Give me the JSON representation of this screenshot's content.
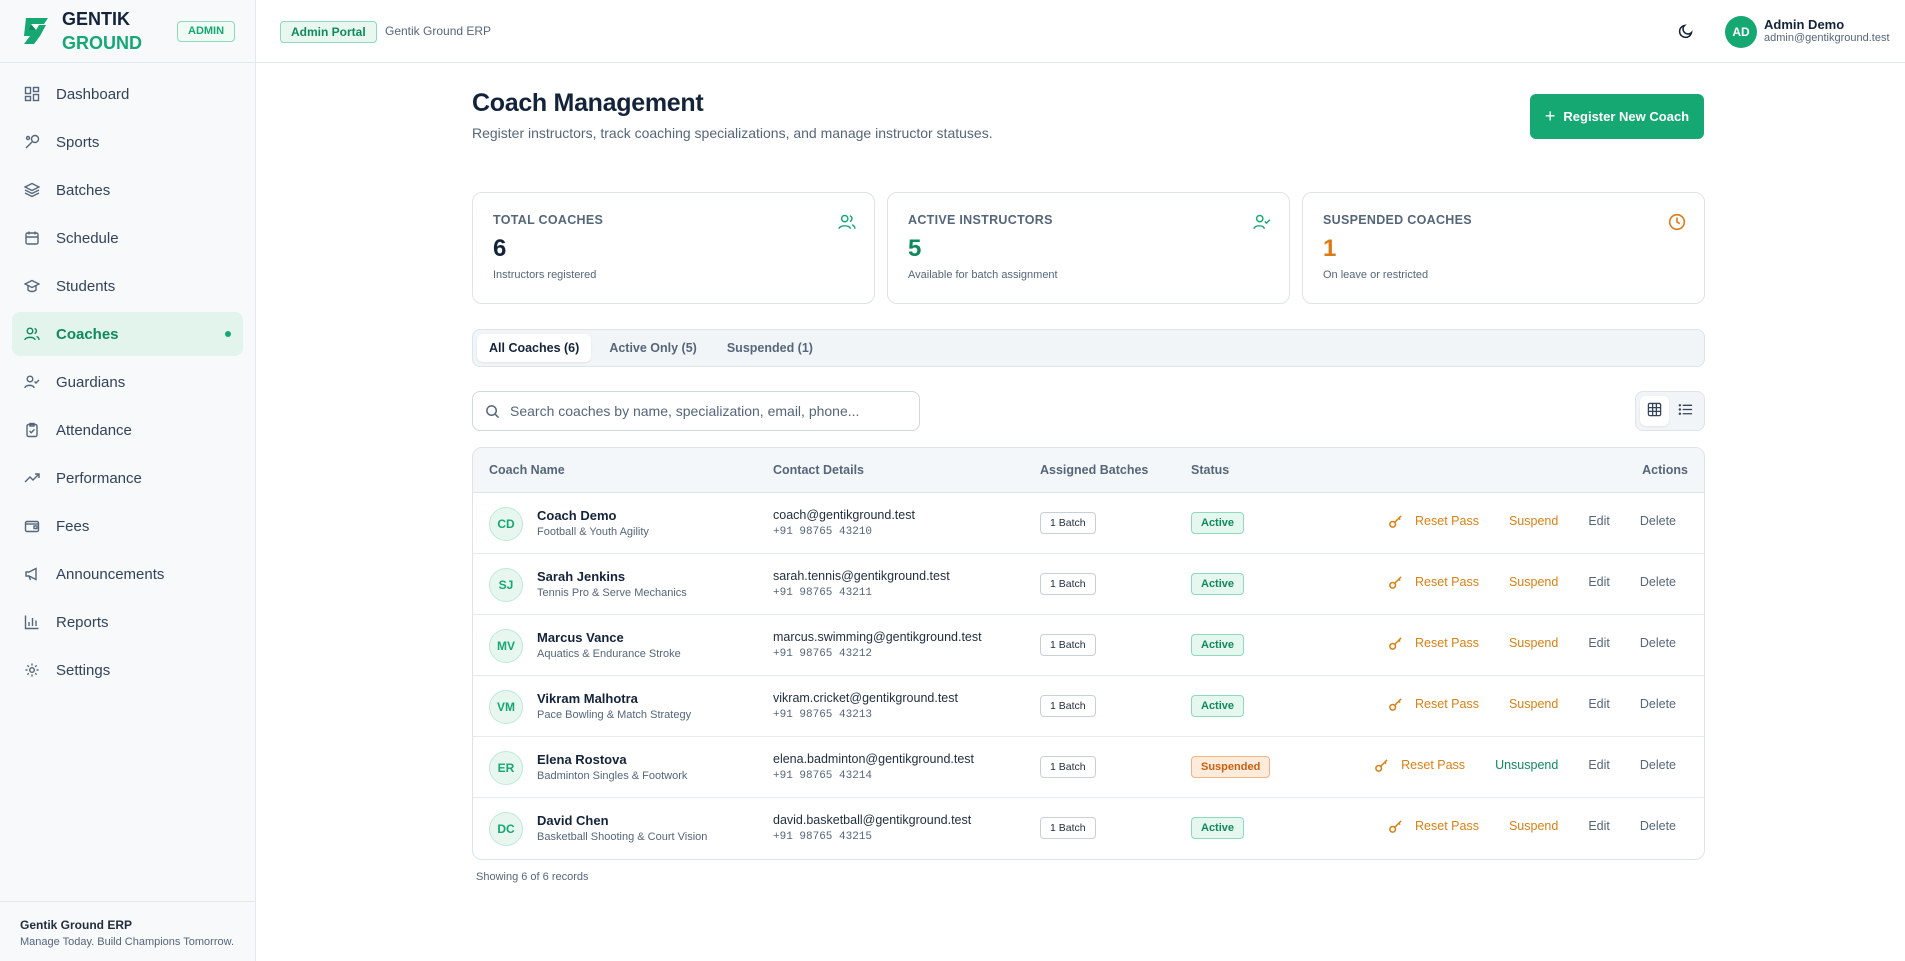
{
  "brand": {
    "line1": "GENTIK",
    "line2": "GROUND",
    "badge": "ADMIN"
  },
  "topbar": {
    "portal_badge": "Admin Portal",
    "portal_sub": "Gentik Ground ERP",
    "theme_icon": "moon-icon"
  },
  "user": {
    "initials": "AD",
    "name": "Admin Demo",
    "email": "admin@gentikground.test"
  },
  "sidebar": {
    "items": [
      {
        "label": "Dashboard",
        "icon": "dashboard-icon"
      },
      {
        "label": "Sports",
        "icon": "sports-icon"
      },
      {
        "label": "Batches",
        "icon": "layers-icon"
      },
      {
        "label": "Schedule",
        "icon": "calendar-icon"
      },
      {
        "label": "Students",
        "icon": "graduation-cap-icon"
      },
      {
        "label": "Coaches",
        "icon": "users-icon",
        "active": true
      },
      {
        "label": "Guardians",
        "icon": "user-check-icon"
      },
      {
        "label": "Attendance",
        "icon": "clipboard-check-icon"
      },
      {
        "label": "Performance",
        "icon": "trending-up-icon"
      },
      {
        "label": "Fees",
        "icon": "wallet-icon"
      },
      {
        "label": "Announcements",
        "icon": "megaphone-icon"
      },
      {
        "label": "Reports",
        "icon": "bar-chart-icon"
      },
      {
        "label": "Settings",
        "icon": "gear-icon"
      }
    ],
    "footer_title": "Gentik Ground ERP",
    "footer_tagline": "Manage Today. Build Champions Tomorrow."
  },
  "page": {
    "title": "Coach Management",
    "subtitle": "Register instructors, track coaching specializations, and manage instructor statuses.",
    "register_button": "Register New Coach"
  },
  "stats": [
    {
      "label": "TOTAL COACHES",
      "value": "6",
      "note": "Instructors registered",
      "icon": "users-icon"
    },
    {
      "label": "ACTIVE INSTRUCTORS",
      "value": "5",
      "note": "Available for batch assignment",
      "icon": "user-check-icon"
    },
    {
      "label": "SUSPENDED COACHES",
      "value": "1",
      "note": "On leave or restricted",
      "icon": "clock-icon"
    }
  ],
  "tabs": [
    "All Coaches (6)",
    "Active Only (5)",
    "Suspended (1)"
  ],
  "search": {
    "placeholder": "Search coaches by name, specialization, email, phone..."
  },
  "table": {
    "headers": {
      "name": "Coach Name",
      "contact": "Contact Details",
      "batches": "Assigned Batches",
      "status": "Status",
      "actions": "Actions"
    },
    "actions": {
      "reset": "Reset Pass",
      "suspend": "Suspend",
      "unsuspend": "Unsuspend",
      "edit": "Edit",
      "delete": "Delete"
    },
    "rows": [
      {
        "initials": "CD",
        "name": "Coach Demo",
        "spec": "Football & Youth Agility",
        "email": "coach@gentikground.test",
        "phone": "+91 98765 43210",
        "batches": "1 Batch",
        "status": "Active"
      },
      {
        "initials": "SJ",
        "name": "Sarah Jenkins",
        "spec": "Tennis Pro & Serve Mechanics",
        "email": "sarah.tennis@gentikground.test",
        "phone": "+91 98765 43211",
        "batches": "1 Batch",
        "status": "Active"
      },
      {
        "initials": "MV",
        "name": "Marcus Vance",
        "spec": "Aquatics & Endurance Stroke",
        "email": "marcus.swimming@gentikground.test",
        "phone": "+91 98765 43212",
        "batches": "1 Batch",
        "status": "Active"
      },
      {
        "initials": "VM",
        "name": "Vikram Malhotra",
        "spec": "Pace Bowling & Match Strategy",
        "email": "vikram.cricket@gentikground.test",
        "phone": "+91 98765 43213",
        "batches": "1 Batch",
        "status": "Active"
      },
      {
        "initials": "ER",
        "name": "Elena Rostova",
        "spec": "Badminton Singles & Footwork",
        "email": "elena.badminton@gentikground.test",
        "phone": "+91 98765 43214",
        "batches": "1 Batch",
        "status": "Suspended"
      },
      {
        "initials": "DC",
        "name": "David Chen",
        "spec": "Basketball Shooting & Court Vision",
        "email": "david.basketball@gentikground.test",
        "phone": "+91 98765 43215",
        "batches": "1 Batch",
        "status": "Active"
      }
    ]
  },
  "footer_note": "Showing 6 of 6 records",
  "colors": {
    "accent": "#16a873",
    "accent_dark": "#0f8a5f",
    "warning": "#d98012",
    "text": "#13233a",
    "muted": "#55667a"
  }
}
